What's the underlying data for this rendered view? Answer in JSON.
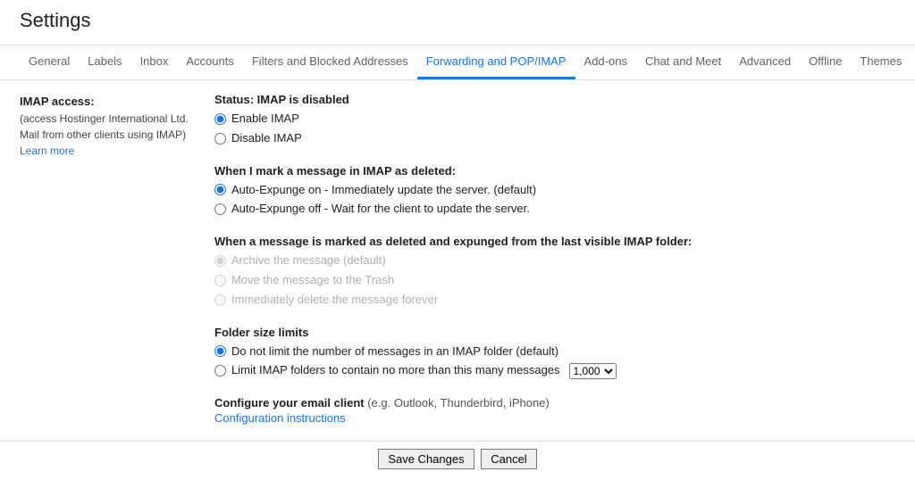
{
  "page_title": "Settings",
  "tabs": [
    {
      "label": "General"
    },
    {
      "label": "Labels"
    },
    {
      "label": "Inbox"
    },
    {
      "label": "Accounts"
    },
    {
      "label": "Filters and Blocked Addresses"
    },
    {
      "label": "Forwarding and POP/IMAP"
    },
    {
      "label": "Add-ons"
    },
    {
      "label": "Chat and Meet"
    },
    {
      "label": "Advanced"
    },
    {
      "label": "Offline"
    },
    {
      "label": "Themes"
    }
  ],
  "active_tab_index": 5,
  "left": {
    "heading": "IMAP access:",
    "sub": "(access Hostinger International Ltd. Mail from other clients using IMAP)",
    "learn_more": "Learn more"
  },
  "status": {
    "title": "Status: IMAP is disabled",
    "enable": "Enable IMAP",
    "disable": "Disable IMAP"
  },
  "deleted": {
    "title": "When I mark a message in IMAP as deleted:",
    "on": "Auto-Expunge on - Immediately update the server. (default)",
    "off": "Auto-Expunge off - Wait for the client to update the server."
  },
  "expunged": {
    "title": "When a message is marked as deleted and expunged from the last visible IMAP folder:",
    "archive": "Archive the message (default)",
    "trash": "Move the message to the Trash",
    "delete": "Immediately delete the message forever"
  },
  "folder": {
    "title": "Folder size limits",
    "nolimit": "Do not limit the number of messages in an IMAP folder (default)",
    "limit": "Limit IMAP folders to contain no more than this many messages",
    "limit_value": "1,000"
  },
  "configure": {
    "title": "Configure your email client",
    "note": " (e.g. Outlook, Thunderbird, iPhone)",
    "link": "Configuration instructions"
  },
  "buttons": {
    "save": "Save Changes",
    "cancel": "Cancel"
  }
}
